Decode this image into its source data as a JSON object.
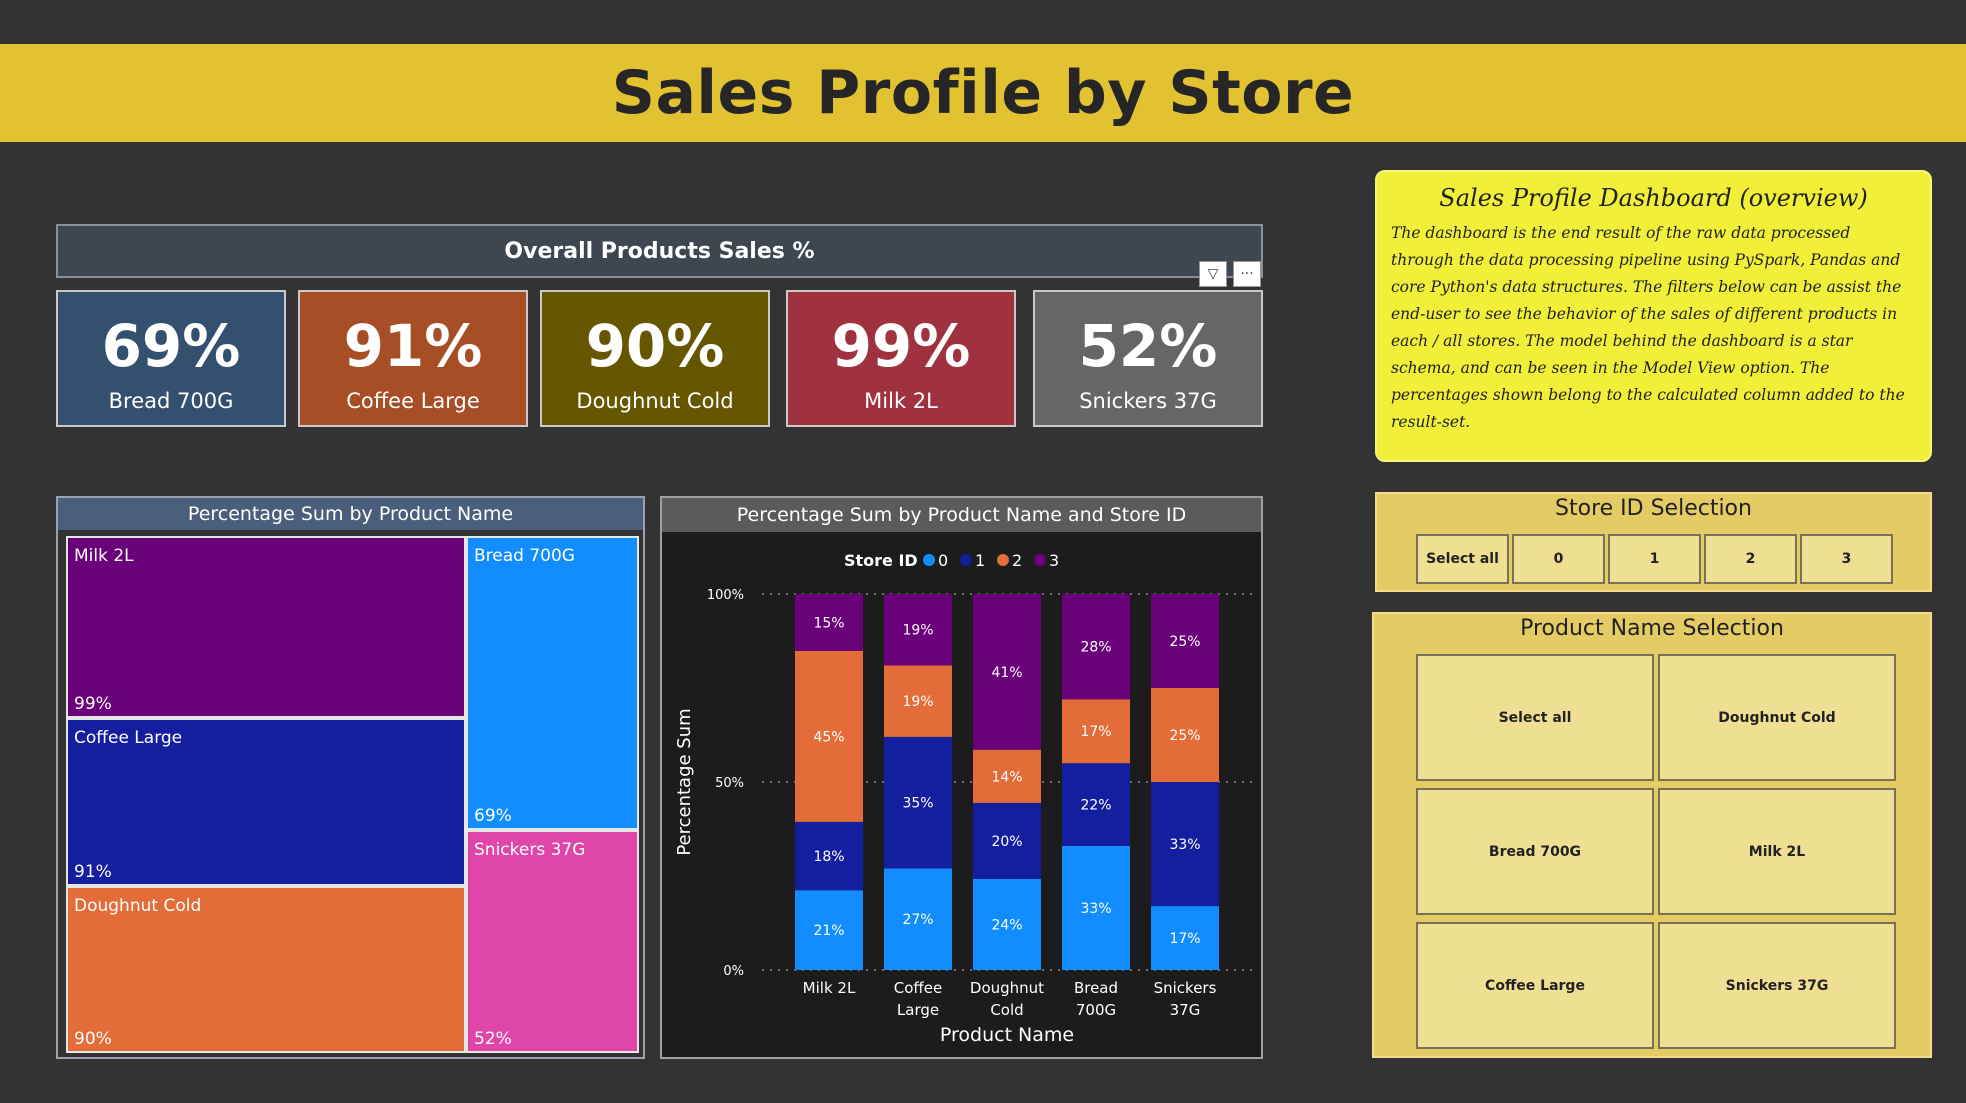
{
  "page": {
    "title": "Sales Profile by Store"
  },
  "kpi": {
    "header": "Overall Products Sales %",
    "filter_icon": "filter-icon",
    "more_icon": "more-options-icon",
    "more_glyph": "···",
    "filter_glyph": "▽",
    "cards": [
      {
        "value": "69%",
        "label": "Bread 700G",
        "color": "#33506f"
      },
      {
        "value": "91%",
        "label": "Coffee Large",
        "color": "#a84e27"
      },
      {
        "value": "90%",
        "label": "Doughnut Cold",
        "color": "#665600"
      },
      {
        "value": "99%",
        "label": "Milk 2L",
        "color": "#a0313e"
      },
      {
        "value": "52%",
        "label": "Snickers 37G",
        "color": "#666666"
      }
    ]
  },
  "treemap": {
    "title": "Percentage Sum by Product Name",
    "cells": [
      {
        "name": "Milk 2L",
        "pct": "99%",
        "color": "#6a007a"
      },
      {
        "name": "Coffee Large",
        "pct": "91%",
        "color": "#141fa0"
      },
      {
        "name": "Doughnut Cold",
        "pct": "90%",
        "color": "#e46c38"
      },
      {
        "name": "Bread 700G",
        "pct": "69%",
        "color": "#118dff"
      },
      {
        "name": "Snickers 37G",
        "pct": "52%",
        "color": "#e045a8"
      }
    ]
  },
  "bar_chart": {
    "title": "Percentage Sum by Product Name and Store ID",
    "legend_title": "Store ID",
    "y_axis_ticks": [
      "100%",
      "50%",
      "0%"
    ]
  },
  "chart_data": {
    "type": "bar",
    "stacked": "100%",
    "title": "Percentage Sum by Product Name and Store ID",
    "xlabel": "Product Name",
    "ylabel": "Percentage Sum",
    "ylim": [
      0,
      100
    ],
    "legend_title": "Store ID",
    "legend_position": "top",
    "categories": [
      "Milk 2L",
      "Coffee Large",
      "Doughnut Cold",
      "Bread 700G",
      "Snickers 37G"
    ],
    "category_lines": [
      [
        "Milk 2L"
      ],
      [
        "Coffee",
        "Large"
      ],
      [
        "Doughnut",
        "Cold"
      ],
      [
        "Bread",
        "700G"
      ],
      [
        "Snickers",
        "37G"
      ]
    ],
    "series": [
      {
        "name": "0",
        "color": "#118dff",
        "values": [
          21,
          27,
          24,
          33,
          17
        ]
      },
      {
        "name": "1",
        "color": "#141fa0",
        "values": [
          18,
          35,
          20,
          22,
          33
        ]
      },
      {
        "name": "2",
        "color": "#e46c38",
        "values": [
          45,
          19,
          14,
          17,
          25
        ]
      },
      {
        "name": "3",
        "color": "#6a007a",
        "values": [
          15,
          19,
          41,
          28,
          25
        ]
      }
    ]
  },
  "info": {
    "title": "Sales Profile Dashboard (overview)",
    "body": "The dashboard is the end result of the raw data processed through the data processing pipeline using PySpark, Pandas and core Python's data structures. The filters below can be assist the end-user to see the behavior of the sales of different products in each / all stores. The model behind the dashboard is a star schema, and can be seen in the Model View option. The percentages shown belong to the calculated column added to the result-set."
  },
  "store_slicer": {
    "title": "Store ID Selection",
    "options": [
      "Select all",
      "0",
      "1",
      "2",
      "3"
    ]
  },
  "product_slicer": {
    "title": "Product Name Selection",
    "options": [
      "Select all",
      "Doughnut Cold",
      "Bread 700G",
      "Milk 2L",
      "Coffee Large",
      "Snickers 37G"
    ]
  }
}
